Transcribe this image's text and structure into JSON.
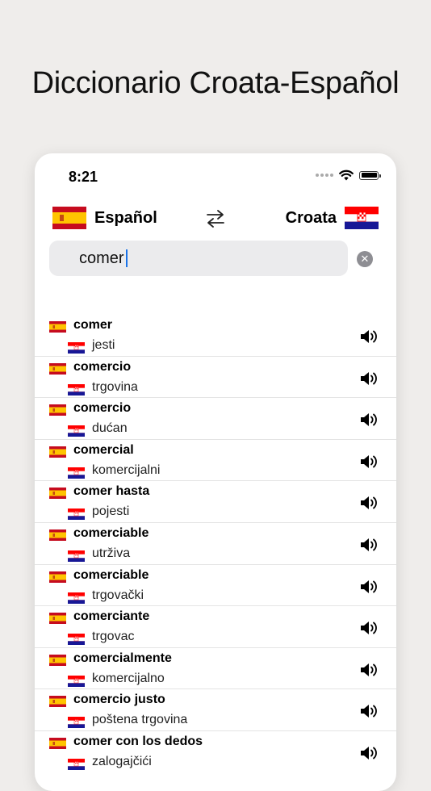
{
  "headline": "Diccionario Croata-Español",
  "status": {
    "time": "8:21"
  },
  "languages": {
    "source": "Español",
    "target": "Croata"
  },
  "search": {
    "value": "comer"
  },
  "results": [
    {
      "term": "comer",
      "translation": "jesti"
    },
    {
      "term": "comercio",
      "translation": "trgovina"
    },
    {
      "term": "comercio",
      "translation": "dućan"
    },
    {
      "term": "comercial",
      "translation": "komercijalni"
    },
    {
      "term": "comer hasta",
      "translation": "pojesti"
    },
    {
      "term": "comerciable",
      "translation": "utrživa"
    },
    {
      "term": "comerciable",
      "translation": "trgovački"
    },
    {
      "term": "comerciante",
      "translation": "trgovac"
    },
    {
      "term": "comercialmente",
      "translation": "komercijalno"
    },
    {
      "term": "comercio justo",
      "translation": "poštena trgovina"
    },
    {
      "term": "comer con los dedos",
      "translation": "zalogajčići"
    }
  ],
  "icons": {
    "swap": "swap-arrows-icon",
    "clear": "clear-circle-icon",
    "speaker": "speaker-icon",
    "wifi": "wifi-icon",
    "battery": "battery-icon"
  },
  "colors": {
    "background": "#efedeb",
    "spain_red": "#c60b1e",
    "spain_yellow": "#ffc400",
    "croatia_red": "#ff0000",
    "croatia_blue": "#171796",
    "cursor": "#1a73e8"
  }
}
